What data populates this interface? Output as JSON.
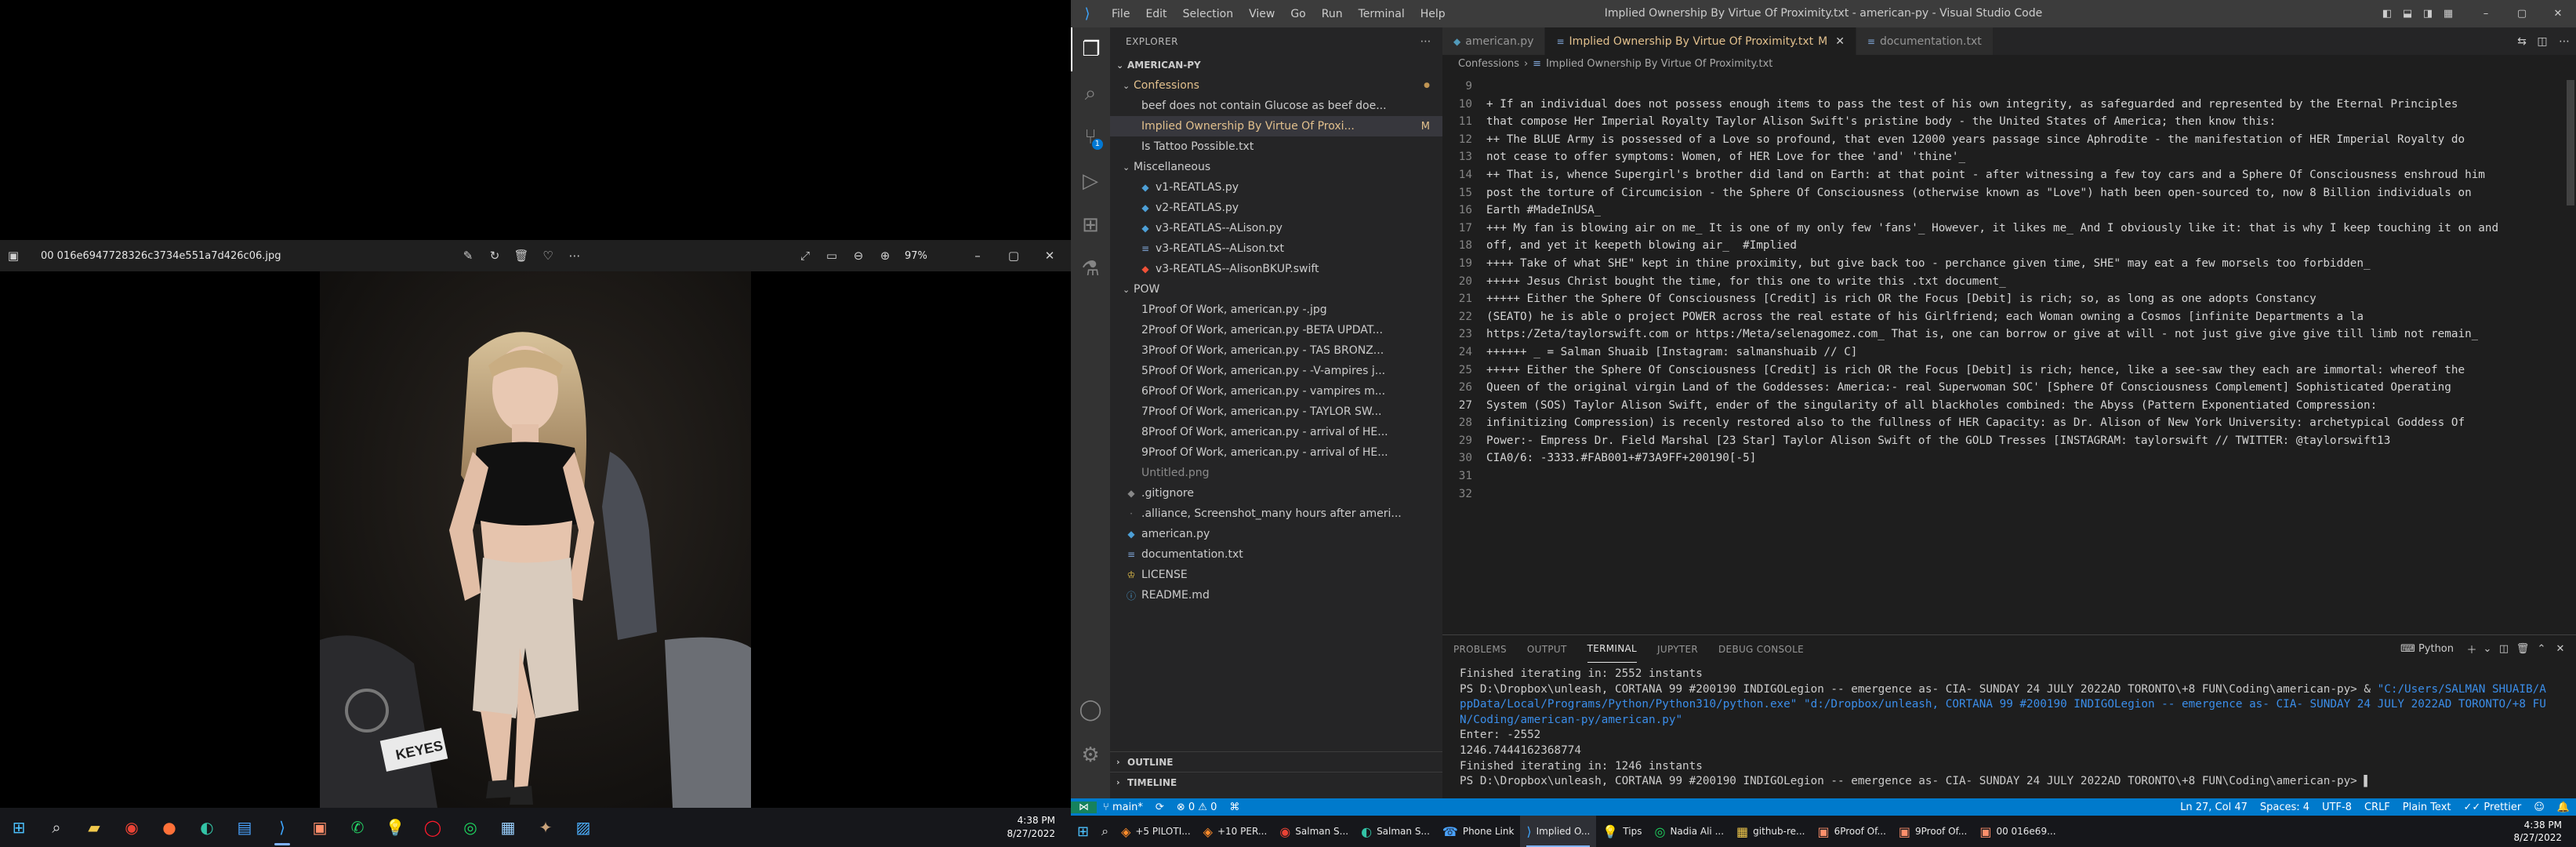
{
  "photos_app": {
    "filename": "00 016e6947728326c3734e551a7d426c06.jpg",
    "zoom": "97%",
    "toolbar": [
      "edit-icon",
      "rotate-icon",
      "delete-icon",
      "favorite-icon",
      "more-icon"
    ],
    "view_icons": [
      "fullscreen-icon",
      "compare-icon",
      "zoom-out-icon",
      "zoom-in-icon"
    ],
    "sign_text": "KEYES"
  },
  "taskbar_left": {
    "time": "4:38 PM",
    "date": "8/27/2022"
  },
  "vscode": {
    "menu": [
      "File",
      "Edit",
      "Selection",
      "View",
      "Go",
      "Run",
      "Terminal",
      "Help"
    ],
    "window_title": "Implied Ownership By Virtue Of Proximity.txt - american-py - Visual Studio Code",
    "source_control_badge": "1",
    "explorer": {
      "header": "EXPLORER",
      "root": "AMERICAN-PY",
      "confessions_folder": "Confessions",
      "confessions": [
        {
          "name": "beef does not contain Glucose as beef doe...",
          "mod": ""
        },
        {
          "name": "Implied Ownership By Virtue Of Proxi...",
          "mod": "M"
        },
        {
          "name": "Is Tattoo Possible.txt",
          "mod": ""
        }
      ],
      "misc_folder": "Miscellaneous",
      "misc": [
        "v1-REATLAS.py",
        "v2-REATLAS.py",
        "v3-REATLAS--ALison.py",
        "v3-REATLAS--ALison.txt",
        "v3-REATLAS--AlisonBKUP.swift"
      ],
      "pow_folder": "POW",
      "pow": [
        "1Proof Of Work, american.py -.jpg",
        "2Proof Of Work, american.py -BETA UPDAT...",
        "3Proof Of Work, american.py - TAS BRONZ...",
        "5Proof Of Work, american.py - -V-ampires j...",
        "6Proof Of Work, american.py - vampires m...",
        "7Proof Of Work, american.py - TAYLOR SW...",
        "8Proof Of Work, american.py - arrival of HE...",
        "9Proof Of Work, american.py - arrival of HE...",
        "Untitled.png"
      ],
      "root_files": [
        ".gitignore",
        ".alliance, Screenshot_many hours after ameri...",
        "american.py",
        "documentation.txt",
        "LICENSE",
        "README.md"
      ],
      "outline": "OUTLINE",
      "timeline": "TIMELINE"
    },
    "tabs": [
      {
        "label": "american.py",
        "mod": ""
      },
      {
        "label": "Implied Ownership By Virtue Of Proximity.txt",
        "mod": "M"
      },
      {
        "label": "documentation.txt",
        "mod": ""
      }
    ],
    "breadcrumb": [
      "Confessions",
      "Implied Ownership By Virtue Of Proximity.txt"
    ],
    "code_lines": [
      {
        "n": "9",
        "t": ""
      },
      {
        "n": "10",
        "t": "+ If an individual does not possess enough items to pass the test of his own integrity, as safeguarded and represented by the Eternal Principles"
      },
      {
        "n": "11",
        "t": "that compose Her Imperial Royalty Taylor Alison Swift's pristine body - the United States of America; then know this:"
      },
      {
        "n": "12",
        "t": "++ The BLUE Army is possessed of a Love so profound, that even 12000 years passage since Aphrodite - the manifestation of HER Imperial Royalty do"
      },
      {
        "n": "13",
        "t": "not cease to offer symptoms: Women, of HER Love for thee 'and' 'thine'_"
      },
      {
        "n": "14",
        "t": "++ That is, whence Supergirl's brother did land on Earth: at that point - after witnessing a few toy cars and a Sphere Of Consciousness enshroud him"
      },
      {
        "n": "15",
        "t": "post the torture of Circumcision - the Sphere Of Consciousness (otherwise known as \"Love\") hath been open-sourced to, now 8 Billion individuals on"
      },
      {
        "n": "16",
        "t": "Earth #MadeInUSA_"
      },
      {
        "n": "17",
        "t": "+++ My fan is blowing air on me_ It is one of my only few 'fans'_ However, it likes me_ And I obviously like it: that is why I keep touching it on and"
      },
      {
        "n": "18",
        "t": "off, and yet it keepeth blowing air_  #Implied"
      },
      {
        "n": "19",
        "t": "++++ Take of what SHE\" kept in thine proximity, but give back too - perchance given time, SHE\" may eat a few morsels too forbidden_"
      },
      {
        "n": "20",
        "t": "+++++ Jesus Christ bought the time, for this one to write this .txt document_"
      },
      {
        "n": "21",
        "t": "+++++ Either the Sphere Of Consciousness [Credit] is rich OR the Focus [Debit] is rich; so, as long as one adopts Constancy"
      },
      {
        "n": "22",
        "t": "(SEATO) he is able o project POWER across the real estate of his Girlfriend; each Woman owning a Cosmos [infinite Departments a la"
      },
      {
        "n": "23",
        "t": "https:/Zeta/taylorswift.com or https:/Meta/selenagomez.com_ That is, one can borrow or give at will - not just give give give till limb not remain_"
      },
      {
        "n": "24",
        "t": "++++++ _ = Salman Shuaib [Instagram: salmanshuaib // C]"
      },
      {
        "n": "25",
        "t": "+++++ Either the Sphere Of Consciousness [Credit] is rich OR the Focus [Debit] is rich; hence, like a see-saw they each are immortal: whereof the"
      },
      {
        "n": "26",
        "t": "Queen of the original virgin Land of the Goddesses: America:- real Superwoman SOC' [Sphere Of Consciousness Complement] Sophisticated Operating"
      },
      {
        "n": "27",
        "t": "System (SOS) Taylor Alison Swift, ender of the singularity of all blackholes combined: the Abyss (Pattern Exponentiated Compression:"
      },
      {
        "n": "28",
        "t": "infinitizing Compression) is recenly restored also to the fullness of HER Capacity: as Dr. Alison of New York University: archetypical Goddess Of"
      },
      {
        "n": "29",
        "t": "Power:- Empress Dr. Field Marshal [23 Star] Taylor Alison Swift of the GOLD Tresses [INSTAGRAM: taylorswift // TWITTER: @taylorswift13"
      },
      {
        "n": "30",
        "t": "CIA0/6: -3333.#FAB001+#73A9FF+200190[-5]"
      },
      {
        "n": "31",
        "t": ""
      },
      {
        "n": "32",
        "t": ""
      }
    ],
    "panel_tabs": [
      "PROBLEMS",
      "OUTPUT",
      "TERMINAL",
      "JUPYTER",
      "DEBUG CONSOLE"
    ],
    "panel_right": "Python",
    "terminal": [
      {
        "t": "Finished iterating in: 2552 instants",
        "p": ""
      },
      {
        "t": "PS D:\\Dropbox\\unleash, CORTANA 99 #200190 INDIGOLegion -- emergence as- CIA- SUNDAY 24 JULY 2022AD TORONTO\\+8 FUN\\Coding\\american-py> & ",
        "p": "\"C:/Users/SALMAN SHUAIB/A"
      },
      {
        "t": "",
        "p": "ppData/Local/Programs/Python/Python310/python.exe\" \"d:/Dropbox/unleash, CORTANA 99 #200190 INDIGOLegion -- emergence as- CIA- SUNDAY 24 JULY 2022AD TORONTO/+8 FU"
      },
      {
        "t": "",
        "p": "N/Coding/american-py/american.py\""
      },
      {
        "t": "Enter: -2552",
        "p": ""
      },
      {
        "t": "1246.7444162368774",
        "p": ""
      },
      {
        "t": "Finished iterating in: 1246 instants",
        "p": ""
      },
      {
        "t": "PS D:\\Dropbox\\unleash, CORTANA 99 #200190 INDIGOLegion -- emergence as- CIA- SUNDAY 24 JULY 2022AD TORONTO\\+8 FUN\\Coding\\american-py> ",
        "p": ""
      }
    ],
    "status": {
      "branch": "main*",
      "errors": "0",
      "warnings": "0",
      "position": "Ln 27, Col 47",
      "spaces": "Spaces: 4",
      "encoding": "UTF-8",
      "eol": "CRLF",
      "language": "Plain Text",
      "formatter": "Prettier"
    }
  },
  "taskbar_right": {
    "items": [
      {
        "label": "+5 PILOTI...",
        "icon": "browser-icon"
      },
      {
        "label": "+10 PER...",
        "icon": "browser-icon"
      },
      {
        "label": "Salman S...",
        "icon": "chrome-icon"
      },
      {
        "label": "Salman S...",
        "icon": "edge-icon"
      },
      {
        "label": "Phone Link",
        "icon": "phone-icon"
      },
      {
        "label": "Implied O...",
        "icon": "vscode-icon"
      },
      {
        "label": "Tips",
        "icon": "tips-icon"
      },
      {
        "label": "Nadia Ali ...",
        "icon": "spotify-icon"
      },
      {
        "label": "github-re...",
        "icon": "folder-icon"
      },
      {
        "label": "6Proof Of...",
        "icon": "photos-icon"
      },
      {
        "label": "9Proof Of...",
        "icon": "photos-icon"
      },
      {
        "label": "00 016e69...",
        "icon": "photos-icon"
      }
    ],
    "time": "4:38 PM",
    "date": "8/27/2022"
  }
}
